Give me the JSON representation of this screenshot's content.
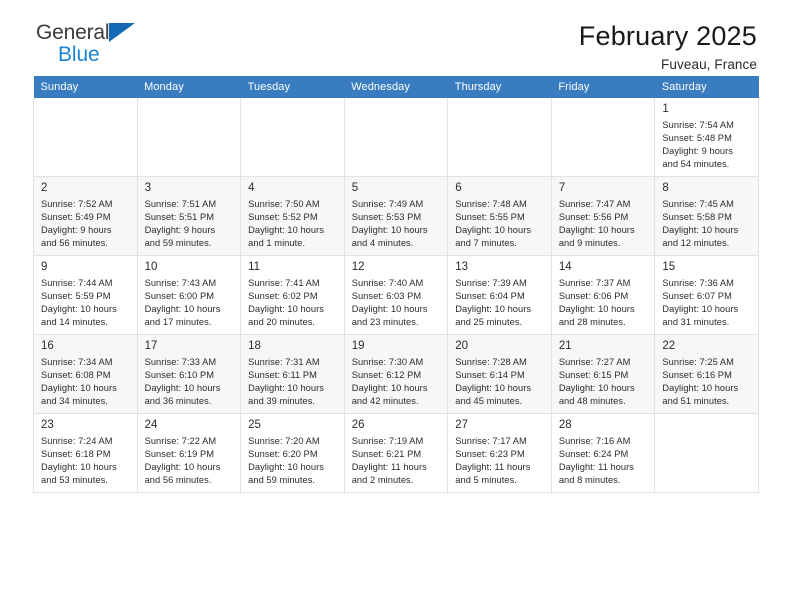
{
  "brand": {
    "name_part1": "General",
    "name_part2": "Blue",
    "logo_icon": "triangle-logo-icon",
    "colors": {
      "accent_blue": "#1a85d6",
      "triangle_blue": "#1469b5"
    }
  },
  "header": {
    "title": "February 2025",
    "subtitle": "Fuveau, France"
  },
  "calendar": {
    "header_bg": "#3a7cc0",
    "weekdays": [
      "Sunday",
      "Monday",
      "Tuesday",
      "Wednesday",
      "Thursday",
      "Friday",
      "Saturday"
    ],
    "weeks": [
      [
        {
          "day": "",
          "empty": true
        },
        {
          "day": "",
          "empty": true
        },
        {
          "day": "",
          "empty": true
        },
        {
          "day": "",
          "empty": true
        },
        {
          "day": "",
          "empty": true
        },
        {
          "day": "",
          "empty": true
        },
        {
          "day": "1",
          "sunrise": "Sunrise: 7:54 AM",
          "sunset": "Sunset: 5:48 PM",
          "daylight_line1": "Daylight: 9 hours",
          "daylight_line2": "and 54 minutes."
        }
      ],
      [
        {
          "day": "2",
          "sunrise": "Sunrise: 7:52 AM",
          "sunset": "Sunset: 5:49 PM",
          "daylight_line1": "Daylight: 9 hours",
          "daylight_line2": "and 56 minutes."
        },
        {
          "day": "3",
          "sunrise": "Sunrise: 7:51 AM",
          "sunset": "Sunset: 5:51 PM",
          "daylight_line1": "Daylight: 9 hours",
          "daylight_line2": "and 59 minutes."
        },
        {
          "day": "4",
          "sunrise": "Sunrise: 7:50 AM",
          "sunset": "Sunset: 5:52 PM",
          "daylight_line1": "Daylight: 10 hours",
          "daylight_line2": "and 1 minute."
        },
        {
          "day": "5",
          "sunrise": "Sunrise: 7:49 AM",
          "sunset": "Sunset: 5:53 PM",
          "daylight_line1": "Daylight: 10 hours",
          "daylight_line2": "and 4 minutes."
        },
        {
          "day": "6",
          "sunrise": "Sunrise: 7:48 AM",
          "sunset": "Sunset: 5:55 PM",
          "daylight_line1": "Daylight: 10 hours",
          "daylight_line2": "and 7 minutes."
        },
        {
          "day": "7",
          "sunrise": "Sunrise: 7:47 AM",
          "sunset": "Sunset: 5:56 PM",
          "daylight_line1": "Daylight: 10 hours",
          "daylight_line2": "and 9 minutes."
        },
        {
          "day": "8",
          "sunrise": "Sunrise: 7:45 AM",
          "sunset": "Sunset: 5:58 PM",
          "daylight_line1": "Daylight: 10 hours",
          "daylight_line2": "and 12 minutes."
        }
      ],
      [
        {
          "day": "9",
          "sunrise": "Sunrise: 7:44 AM",
          "sunset": "Sunset: 5:59 PM",
          "daylight_line1": "Daylight: 10 hours",
          "daylight_line2": "and 14 minutes."
        },
        {
          "day": "10",
          "sunrise": "Sunrise: 7:43 AM",
          "sunset": "Sunset: 6:00 PM",
          "daylight_line1": "Daylight: 10 hours",
          "daylight_line2": "and 17 minutes."
        },
        {
          "day": "11",
          "sunrise": "Sunrise: 7:41 AM",
          "sunset": "Sunset: 6:02 PM",
          "daylight_line1": "Daylight: 10 hours",
          "daylight_line2": "and 20 minutes."
        },
        {
          "day": "12",
          "sunrise": "Sunrise: 7:40 AM",
          "sunset": "Sunset: 6:03 PM",
          "daylight_line1": "Daylight: 10 hours",
          "daylight_line2": "and 23 minutes."
        },
        {
          "day": "13",
          "sunrise": "Sunrise: 7:39 AM",
          "sunset": "Sunset: 6:04 PM",
          "daylight_line1": "Daylight: 10 hours",
          "daylight_line2": "and 25 minutes."
        },
        {
          "day": "14",
          "sunrise": "Sunrise: 7:37 AM",
          "sunset": "Sunset: 6:06 PM",
          "daylight_line1": "Daylight: 10 hours",
          "daylight_line2": "and 28 minutes."
        },
        {
          "day": "15",
          "sunrise": "Sunrise: 7:36 AM",
          "sunset": "Sunset: 6:07 PM",
          "daylight_line1": "Daylight: 10 hours",
          "daylight_line2": "and 31 minutes."
        }
      ],
      [
        {
          "day": "16",
          "sunrise": "Sunrise: 7:34 AM",
          "sunset": "Sunset: 6:08 PM",
          "daylight_line1": "Daylight: 10 hours",
          "daylight_line2": "and 34 minutes."
        },
        {
          "day": "17",
          "sunrise": "Sunrise: 7:33 AM",
          "sunset": "Sunset: 6:10 PM",
          "daylight_line1": "Daylight: 10 hours",
          "daylight_line2": "and 36 minutes."
        },
        {
          "day": "18",
          "sunrise": "Sunrise: 7:31 AM",
          "sunset": "Sunset: 6:11 PM",
          "daylight_line1": "Daylight: 10 hours",
          "daylight_line2": "and 39 minutes."
        },
        {
          "day": "19",
          "sunrise": "Sunrise: 7:30 AM",
          "sunset": "Sunset: 6:12 PM",
          "daylight_line1": "Daylight: 10 hours",
          "daylight_line2": "and 42 minutes."
        },
        {
          "day": "20",
          "sunrise": "Sunrise: 7:28 AM",
          "sunset": "Sunset: 6:14 PM",
          "daylight_line1": "Daylight: 10 hours",
          "daylight_line2": "and 45 minutes."
        },
        {
          "day": "21",
          "sunrise": "Sunrise: 7:27 AM",
          "sunset": "Sunset: 6:15 PM",
          "daylight_line1": "Daylight: 10 hours",
          "daylight_line2": "and 48 minutes."
        },
        {
          "day": "22",
          "sunrise": "Sunrise: 7:25 AM",
          "sunset": "Sunset: 6:16 PM",
          "daylight_line1": "Daylight: 10 hours",
          "daylight_line2": "and 51 minutes."
        }
      ],
      [
        {
          "day": "23",
          "sunrise": "Sunrise: 7:24 AM",
          "sunset": "Sunset: 6:18 PM",
          "daylight_line1": "Daylight: 10 hours",
          "daylight_line2": "and 53 minutes."
        },
        {
          "day": "24",
          "sunrise": "Sunrise: 7:22 AM",
          "sunset": "Sunset: 6:19 PM",
          "daylight_line1": "Daylight: 10 hours",
          "daylight_line2": "and 56 minutes."
        },
        {
          "day": "25",
          "sunrise": "Sunrise: 7:20 AM",
          "sunset": "Sunset: 6:20 PM",
          "daylight_line1": "Daylight: 10 hours",
          "daylight_line2": "and 59 minutes."
        },
        {
          "day": "26",
          "sunrise": "Sunrise: 7:19 AM",
          "sunset": "Sunset: 6:21 PM",
          "daylight_line1": "Daylight: 11 hours",
          "daylight_line2": "and 2 minutes."
        },
        {
          "day": "27",
          "sunrise": "Sunrise: 7:17 AM",
          "sunset": "Sunset: 6:23 PM",
          "daylight_line1": "Daylight: 11 hours",
          "daylight_line2": "and 5 minutes."
        },
        {
          "day": "28",
          "sunrise": "Sunrise: 7:16 AM",
          "sunset": "Sunset: 6:24 PM",
          "daylight_line1": "Daylight: 11 hours",
          "daylight_line2": "and 8 minutes."
        },
        {
          "day": "",
          "empty": true
        }
      ]
    ]
  }
}
